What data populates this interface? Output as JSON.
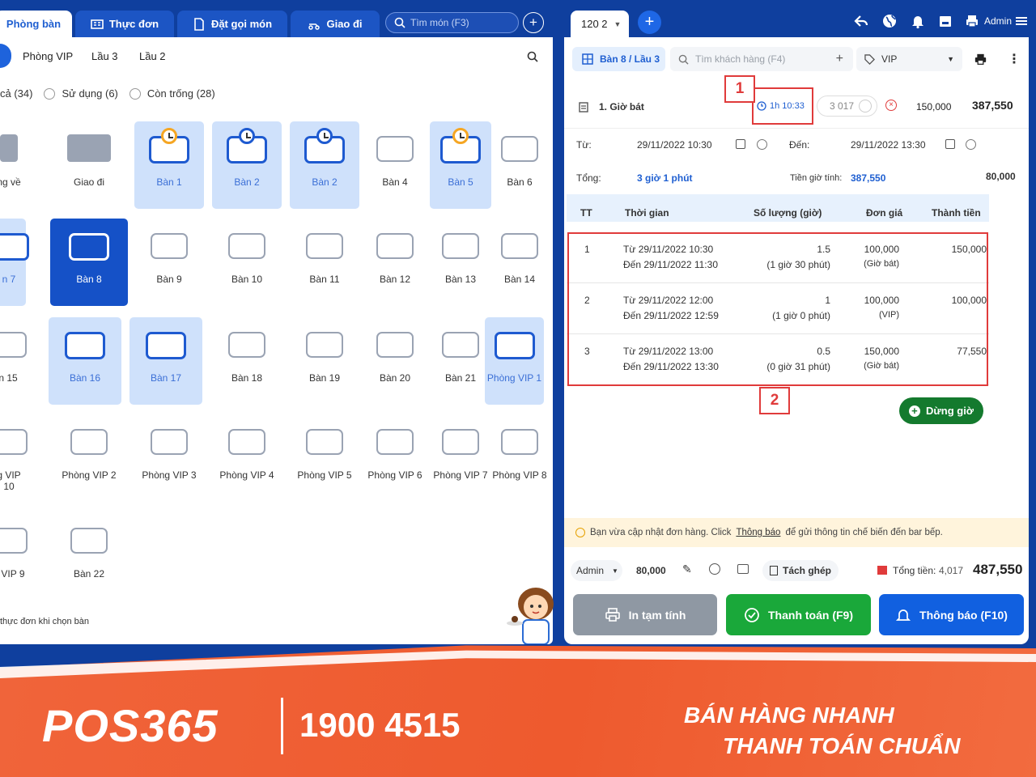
{
  "left_tabs": [
    {
      "label": "Phòng bàn",
      "active": true
    },
    {
      "label": "Thực đơn"
    },
    {
      "label": "Đặt gọi món"
    },
    {
      "label": "Giao đi"
    }
  ],
  "top_search": {
    "placeholder": "Tìm món (F3)"
  },
  "order_tab": {
    "label": "120 2"
  },
  "user": {
    "name": "Admin"
  },
  "floors": [
    "Phòng VIP",
    "Lầu 3",
    "Lầu 2"
  ],
  "filters": [
    "cả (34)",
    "Sử dụng (6)",
    "Còn trống (28)"
  ],
  "tables": [
    {
      "name": "ng về",
      "state": "icon"
    },
    {
      "name": "Giao đi",
      "state": "icon"
    },
    {
      "name": "Bàn 1",
      "state": "busy"
    },
    {
      "name": "Bàn 2",
      "state": "busy"
    },
    {
      "name": "Bàn 2",
      "state": "busy"
    },
    {
      "name": "Bàn 4",
      "state": "free"
    },
    {
      "name": "Bàn 5",
      "state": "busy"
    },
    {
      "name": "Bàn 6",
      "state": "free"
    },
    {
      "name": "n 7",
      "state": "busy"
    },
    {
      "name": "Bàn 8",
      "state": "selected"
    },
    {
      "name": "Bàn 9",
      "state": "free"
    },
    {
      "name": "Bàn 10",
      "state": "free"
    },
    {
      "name": "Bàn 11",
      "state": "free"
    },
    {
      "name": "Bàn 12",
      "state": "free"
    },
    {
      "name": "Bàn 13",
      "state": "free"
    },
    {
      "name": "Bàn 14",
      "state": "free"
    },
    {
      "name": "n 15",
      "state": "free"
    },
    {
      "name": "Bàn 16",
      "state": "busy"
    },
    {
      "name": "Bàn 17",
      "state": "busy"
    },
    {
      "name": "Bàn 18",
      "state": "free"
    },
    {
      "name": "Bàn 19",
      "state": "free"
    },
    {
      "name": "Bàn 20",
      "state": "free"
    },
    {
      "name": "Bàn 21",
      "state": "free"
    },
    {
      "name": "Phòng VIP 1",
      "state": "busy"
    },
    {
      "name": "g VIP 10",
      "state": "free"
    },
    {
      "name": "Phòng VIP 2",
      "state": "free"
    },
    {
      "name": "Phòng VIP 3",
      "state": "free"
    },
    {
      "name": "Phòng VIP 4",
      "state": "free"
    },
    {
      "name": "Phòng VIP 5",
      "state": "free"
    },
    {
      "name": "Phòng VIP 6",
      "state": "free"
    },
    {
      "name": "Phòng VIP 7",
      "state": "free"
    },
    {
      "name": "Phòng VIP 8",
      "state": "free"
    },
    {
      "name": "g VIP 9",
      "state": "free"
    },
    {
      "name": "Bàn 22",
      "state": "free"
    }
  ],
  "left_footer": "thực đơn khi chọn bàn",
  "order": {
    "table_label": "Bàn 8 / Lầu 3",
    "customer_placeholder": "Tìm khách hàng (F4)",
    "price_list": "VIP",
    "item_title": "1. Giờ bát",
    "elapsed": "1h 10:33",
    "qty": "3 017",
    "unit_price": "150,000",
    "amount": "387,550",
    "from_label": "Từ:",
    "from_value": "29/11/2022 10:30",
    "to_label": "Đến:",
    "to_value": "29/11/2022 13:30",
    "total_label": "Tổng:",
    "total_value": "3 giờ 1 phút",
    "fee_label": "Tiền giờ tính:",
    "fee_value": "387,550",
    "extra_value": "80,000",
    "columns": [
      "TT",
      "Thời gian",
      "Số lượng (giờ)",
      "Đơn giá",
      "Thành tiền"
    ],
    "rows": [
      {
        "no": "1",
        "from": "Từ 29/11/2022 10:30",
        "to": "Đến 29/11/2022 11:30",
        "hours": "1.5",
        "duration": "(1 giờ 30 phút)",
        "price": "100,000",
        "price_type": "(Giờ bát)",
        "total": "150,000"
      },
      {
        "no": "2",
        "from": "Từ 29/11/2022 12:00",
        "to": "Đến 29/11/2022 12:59",
        "hours": "1",
        "duration": "(1 giờ 0 phút)",
        "price": "100,000",
        "price_type": "(VIP)",
        "total": "100,000"
      },
      {
        "no": "3",
        "from": "Từ 29/11/2022 13:00",
        "to": "Đến 29/11/2022 13:30",
        "hours": "0.5",
        "duration": "(0 giờ 31 phút)",
        "price": "150,000",
        "price_type": "(Giờ bát)",
        "total": "77,550"
      }
    ],
    "stop_label": "Dừng giờ",
    "annotation_1": "1",
    "annotation_2": "2"
  },
  "notice": {
    "prefix": "Bạn vừa cập nhật đơn hàng. Click",
    "link": "Thông báo",
    "suffix": "để gửi thông tin chế biến đến bar bếp."
  },
  "footer": {
    "staff": "Admin",
    "amount": "80,000",
    "split_label": "Tách ghép",
    "total_label": "Tổng tiền:",
    "total_qty": "4,017",
    "total_amount": "487,550",
    "print_label": "In tạm tính",
    "pay_label": "Thanh toán (F9)",
    "notify_label": "Thông báo (F10)"
  },
  "banner": {
    "logo": "POS365",
    "hotline": "1900 4515",
    "slogan_1": "BÁN HÀNG NHANH",
    "slogan_2": "THANH TOÁN CHUẨN"
  },
  "colors": {
    "primary": "#0f3f9e",
    "accent": "#1f5fd1",
    "pay": "#1aa83a",
    "notify": "#1160e0",
    "print": "#8f98a3",
    "alert": "#e03b3b"
  }
}
